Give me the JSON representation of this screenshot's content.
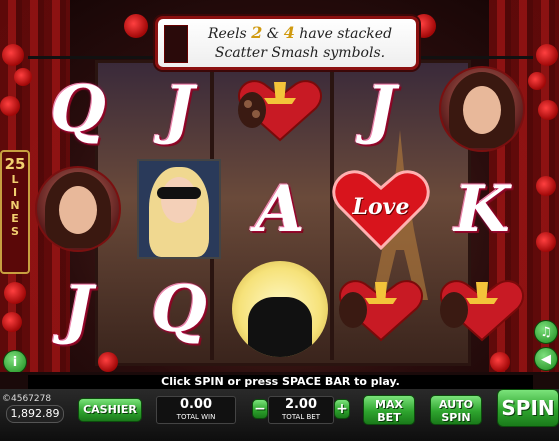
{
  "banner": {
    "line_prefix": "Reels",
    "reel_a": "2",
    "amp": "&",
    "reel_b": "4",
    "line1_suffix": "have stacked",
    "line2": "Scatter Smash symbols."
  },
  "lines": {
    "count": "25",
    "label_letters": [
      "L",
      "I",
      "N",
      "E",
      "S"
    ]
  },
  "reels": {
    "row1": [
      "Q",
      "J",
      "chocolate-heart",
      "J",
      "woman-portrait"
    ],
    "row2": [
      "woman-portrait",
      "blonde-woman",
      "A",
      "love-heart",
      "K"
    ],
    "row3": [
      "J",
      "Q",
      "moon-couple",
      "chocolate-heart",
      "chocolate-heart"
    ],
    "love_text": "Love"
  },
  "message": "Click SPIN or press SPACE BAR to play.",
  "account": {
    "id": "©4567278",
    "balance": "1,892.89"
  },
  "buttons": {
    "cashier": "CASHIER",
    "minus": "−",
    "plus": "+",
    "max_bet_1": "MAX",
    "max_bet_2": "BET",
    "auto_spin_1": "AUTO",
    "auto_spin_2": "SPIN",
    "spin": "SPIN",
    "info": "i"
  },
  "total_win": {
    "value": "0.00",
    "label": "TOTAL WIN"
  },
  "total_bet": {
    "value": "2.00",
    "label": "TOTAL BET"
  },
  "colors": {
    "accent_red": "#8a1010",
    "button_green": "#2ea42e",
    "gold": "#d09a10"
  }
}
